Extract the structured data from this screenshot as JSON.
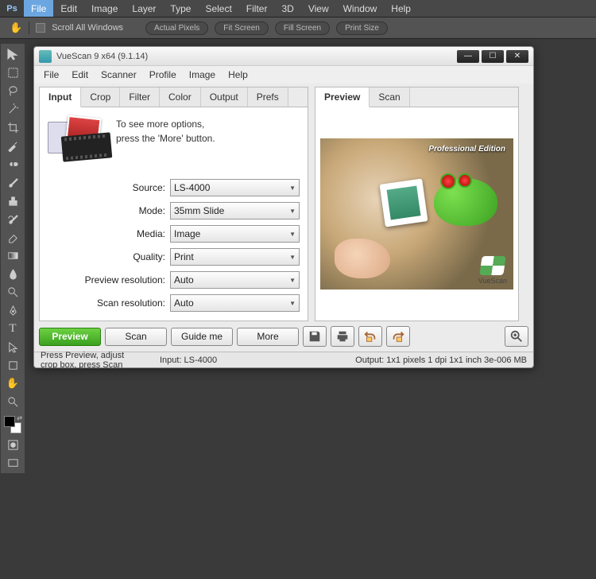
{
  "ps": {
    "menu": {
      "file": "File",
      "edit": "Edit",
      "image": "Image",
      "layer": "Layer",
      "type": "Type",
      "select": "Select",
      "filter": "Filter",
      "threeD": "3D",
      "view": "View",
      "window": "Window",
      "help": "Help"
    },
    "options": {
      "scrollAll": "Scroll All Windows",
      "actualPixels": "Actual Pixels",
      "fitScreen": "Fit Screen",
      "fillScreen": "Fill Screen",
      "printSize": "Print Size"
    }
  },
  "vs": {
    "title": "VueScan 9 x64 (9.1.14)",
    "menu": {
      "file": "File",
      "edit": "Edit",
      "scanner": "Scanner",
      "profile": "Profile",
      "image": "Image",
      "help": "Help"
    },
    "tabs": {
      "input": "Input",
      "crop": "Crop",
      "filter": "Filter",
      "color": "Color",
      "output": "Output",
      "prefs": "Prefs"
    },
    "rightTabs": {
      "preview": "Preview",
      "scan": "Scan"
    },
    "hint": {
      "line1": "To see more options,",
      "line2": "press the 'More' button."
    },
    "fields": {
      "source": {
        "label": "Source:",
        "value": "LS-4000"
      },
      "mode": {
        "label": "Mode:",
        "value": "35mm Slide"
      },
      "media": {
        "label": "Media:",
        "value": "Image"
      },
      "quality": {
        "label": "Quality:",
        "value": "Print"
      },
      "previewRes": {
        "label": "Preview resolution:",
        "value": "Auto"
      },
      "scanRes": {
        "label": "Scan resolution:",
        "value": "Auto"
      }
    },
    "buttons": {
      "preview": "Preview",
      "scan": "Scan",
      "guide": "Guide me",
      "more": "More"
    },
    "previewImage": {
      "edition": "Professional Edition",
      "logo": "VueScan"
    },
    "status": {
      "left": "Press Preview, adjust crop box, press Scan",
      "input": "Input: LS-4000",
      "output": "Output: 1x1 pixels 1 dpi 1x1 inch 3e-006 MB"
    }
  }
}
